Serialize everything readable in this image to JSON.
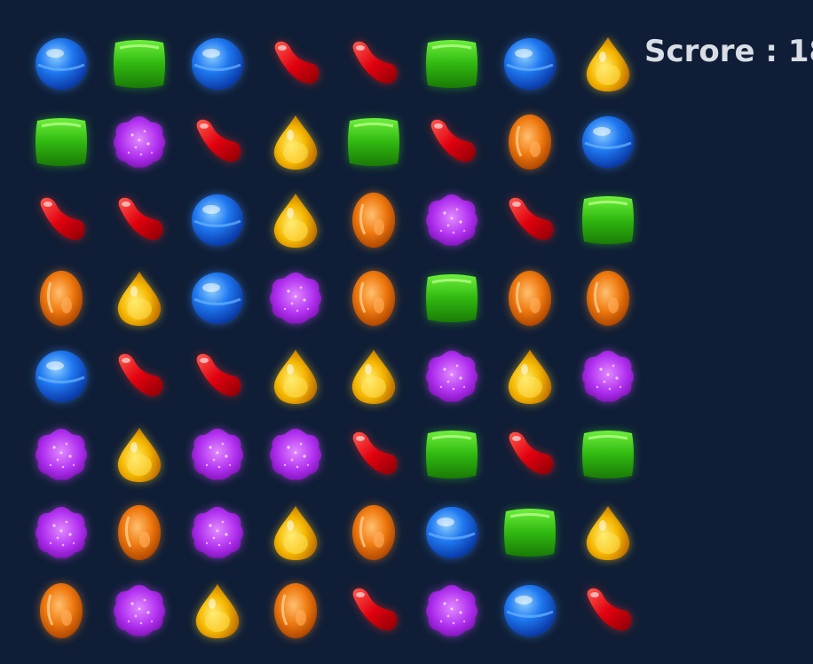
{
  "score": {
    "label": "Scrore : 18"
  },
  "board": [
    [
      "blue",
      "green",
      "blue",
      "red",
      "red",
      "green",
      "blue",
      "yellow"
    ],
    [
      "green",
      "purple",
      "red",
      "yellow",
      "green",
      "red",
      "orange",
      "blue"
    ],
    [
      "red",
      "red",
      "blue",
      "yellow",
      "orange",
      "purple",
      "red",
      "green"
    ],
    [
      "orange",
      "yellow",
      "blue",
      "purple",
      "orange",
      "green",
      "orange",
      "orange"
    ],
    [
      "blue",
      "red",
      "red",
      "yellow",
      "yellow",
      "purple",
      "yellow",
      "purple"
    ],
    [
      "purple",
      "yellow",
      "purple",
      "purple",
      "red",
      "green",
      "red",
      "green"
    ],
    [
      "purple",
      "orange",
      "purple",
      "yellow",
      "orange",
      "blue",
      "green",
      "yellow"
    ],
    [
      "orange",
      "purple",
      "yellow",
      "orange",
      "red",
      "purple",
      "blue",
      "red"
    ]
  ],
  "candy_icons": {
    "blue": "blue-round-candy-icon",
    "green": "green-square-candy-icon",
    "red": "red-bean-candy-icon",
    "yellow": "yellow-drop-candy-icon",
    "orange": "orange-oval-candy-icon",
    "purple": "purple-cluster-candy-icon"
  },
  "colors": {
    "background": "#0f1e36",
    "blue": "#1c6fe8",
    "green": "#2fb80f",
    "red": "#e0000e",
    "yellow": "#f5b800",
    "orange": "#f07a10",
    "purple": "#b030f0"
  }
}
